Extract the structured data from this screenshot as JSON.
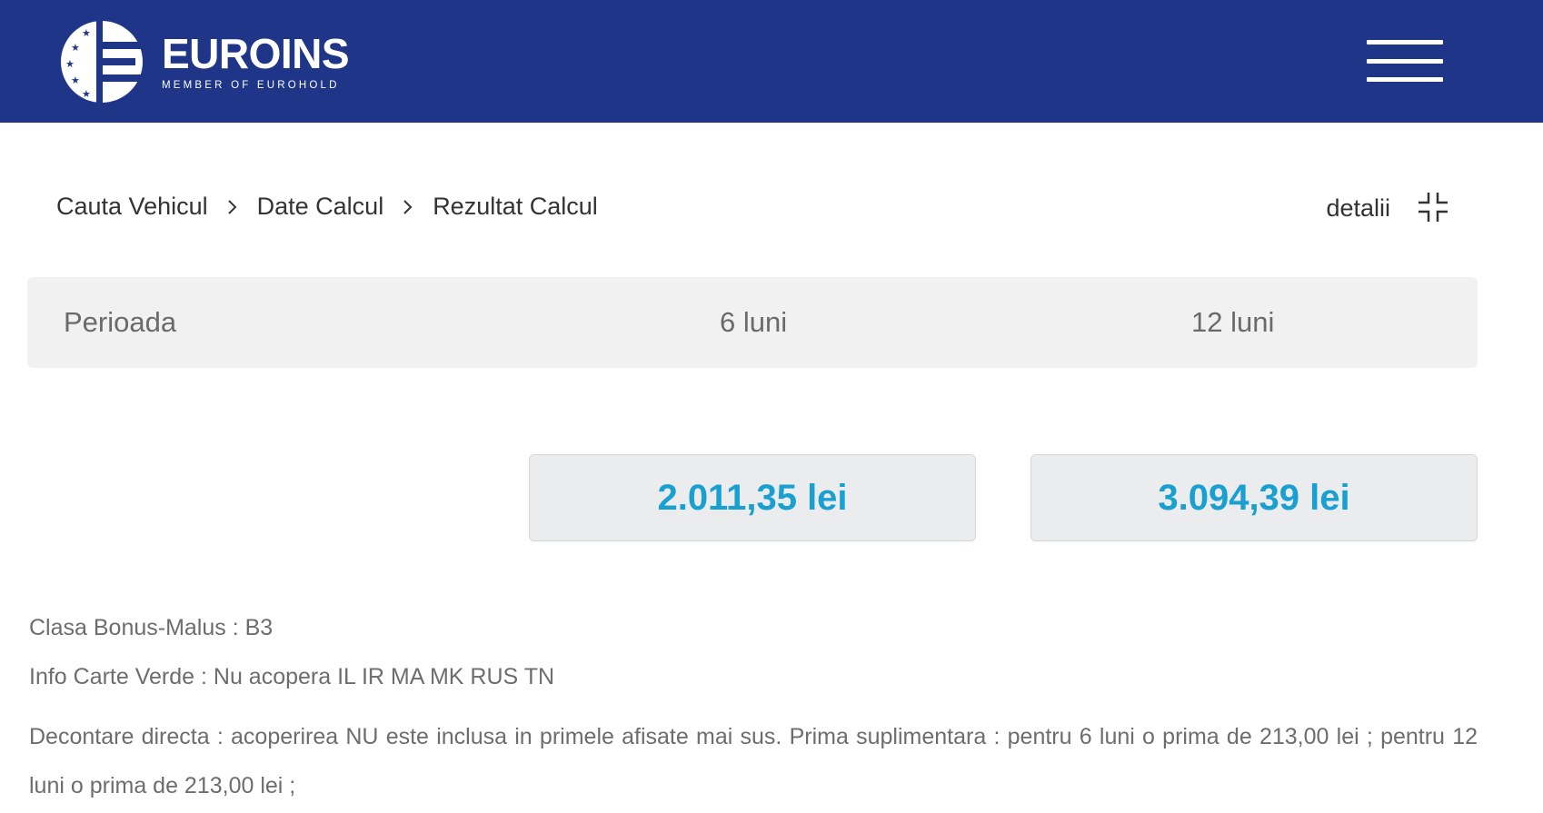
{
  "header": {
    "brand": "EUROINS",
    "tagline": "MEMBER OF EUROHOLD",
    "logo_icon": "euroins-logo-icon",
    "menu_icon": "hamburger-menu-icon",
    "bg_color": "#1f3688"
  },
  "breadcrumb": {
    "items": [
      "Cauta Vehicul",
      "Date Calcul",
      "Rezultat Calcul"
    ],
    "separator_icon": "chevron-right-icon"
  },
  "details": {
    "label": "detalii",
    "icon": "collapse-icon"
  },
  "period": {
    "label": "Perioada",
    "options": [
      "6 luni",
      "12 luni"
    ]
  },
  "prices": [
    {
      "value": "2.011,35 lei"
    },
    {
      "value": "3.094,39 lei"
    }
  ],
  "price_color": "#1aa0d0",
  "info": {
    "bonus_malus": "Clasa Bonus-Malus : B3",
    "green_card": "Info Carte Verde : Nu acopera IL IR MA MK RUS TN",
    "direct_settlement": "Decontare directa : acoperirea NU este inclusa in primele afisate mai sus. Prima suplimentara : pentru 6 luni o prima de 213,00 lei ; pentru 12 luni o prima de 213,00 lei ;"
  }
}
